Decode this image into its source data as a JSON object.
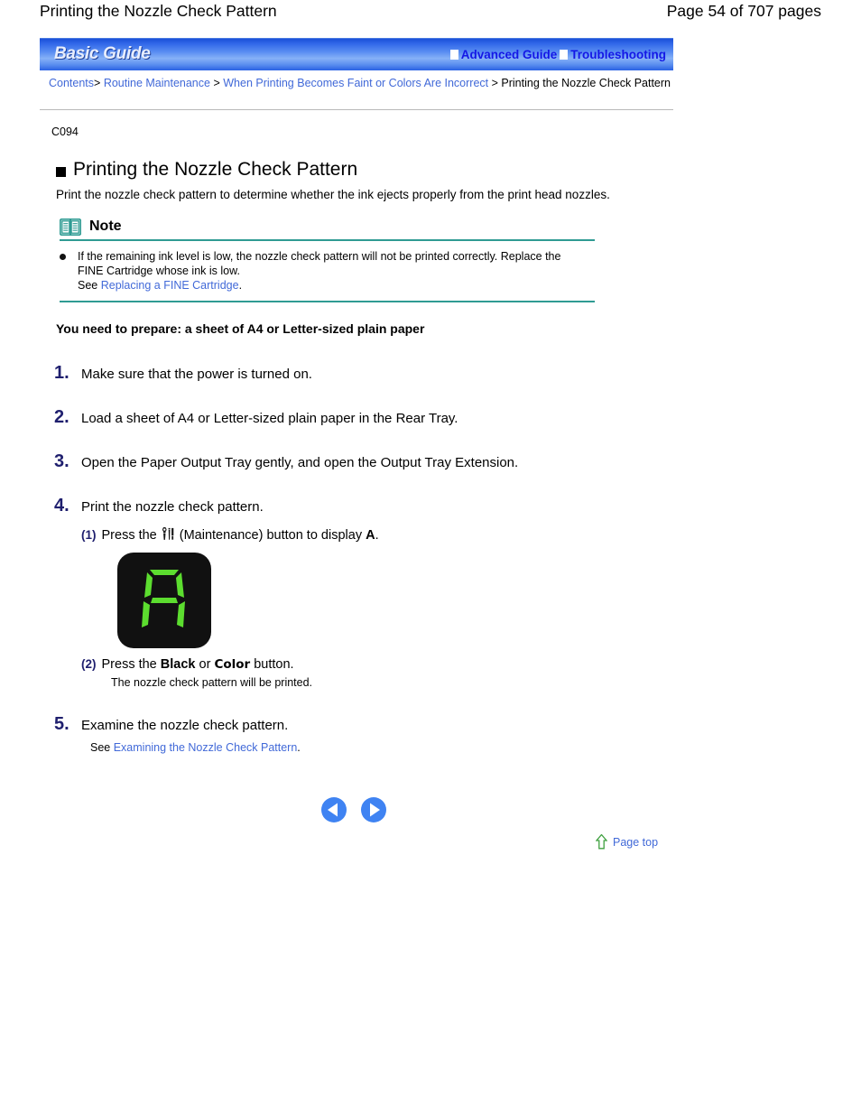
{
  "page_header": {
    "title": "Printing the Nozzle Check Pattern",
    "page_count": "Page 54 of 707 pages"
  },
  "banner": {
    "title": "Basic Guide",
    "links": [
      {
        "label": "Advanced Guide"
      },
      {
        "label": "Troubleshooting"
      }
    ]
  },
  "breadcrumb": {
    "items": [
      {
        "label": "Contents",
        "link": true
      },
      {
        "label": "Routine Maintenance",
        "link": true
      },
      {
        "label": "When Printing Becomes Faint or Colors Are Incorrect",
        "link": true
      },
      {
        "label": "Printing the Nozzle Check Pattern",
        "link": false
      }
    ],
    "separator": ">"
  },
  "doc_id": "C094",
  "section": {
    "heading": "Printing the Nozzle Check Pattern",
    "intro": "Print the nozzle check pattern to determine whether the ink ejects properly from the print head nozzles."
  },
  "note": {
    "title": "Note",
    "icon": "open-book-icon",
    "body_line1": "If the remaining ink level is low, the nozzle check pattern will not be printed correctly. Replace the",
    "body_line2": "FINE Cartridge whose ink is low.",
    "see_prefix": "See ",
    "see_link": "Replacing a FINE Cartridge",
    "see_suffix": "."
  },
  "prepare_line": "You need to prepare: a sheet of A4 or Letter-sized plain paper",
  "steps": [
    {
      "num": "1.",
      "text": "Make sure that the power is turned on."
    },
    {
      "num": "2.",
      "text": "Load a sheet of A4 or Letter-sized plain paper in the Rear Tray."
    },
    {
      "num": "3.",
      "text": "Open the Paper Output Tray gently, and open the Output Tray Extension."
    },
    {
      "num": "4.",
      "text": "Print the nozzle check pattern."
    },
    {
      "num": "5.",
      "text": "Examine the nozzle check pattern."
    }
  ],
  "substeps": {
    "s1_num": "(1)",
    "s1_pre": "Press the",
    "s1_icon": "maintenance-icon",
    "s1_mid": "(Maintenance) button to display",
    "s1_display_char": "A",
    "s1_post": ".",
    "s2_num": "(2)",
    "s2_pre": "Press the",
    "s2_black": "Black",
    "s2_or": "or",
    "s2_color": "Color",
    "s2_post": "button.",
    "s2_note": "The nozzle check pattern will be printed."
  },
  "led_display": {
    "character": "A",
    "segment_color": "#5cdd2f",
    "background_color": "#111111"
  },
  "step5_note": {
    "see_prefix": "See ",
    "see_link": "Examining the Nozzle Check Pattern",
    "see_suffix": "."
  },
  "navigation": {
    "previous_label": "Previous page",
    "next_label": "Next page",
    "page_top_label": "Page top"
  },
  "colors": {
    "link_blue": "#4169d8",
    "banner_link_blue": "#1418e6",
    "step_number_navy": "#1f1f6e",
    "note_rule_teal": "#2f9b93",
    "nav_blue": "#3f83f2",
    "page_top_green": "#3fa03f"
  }
}
